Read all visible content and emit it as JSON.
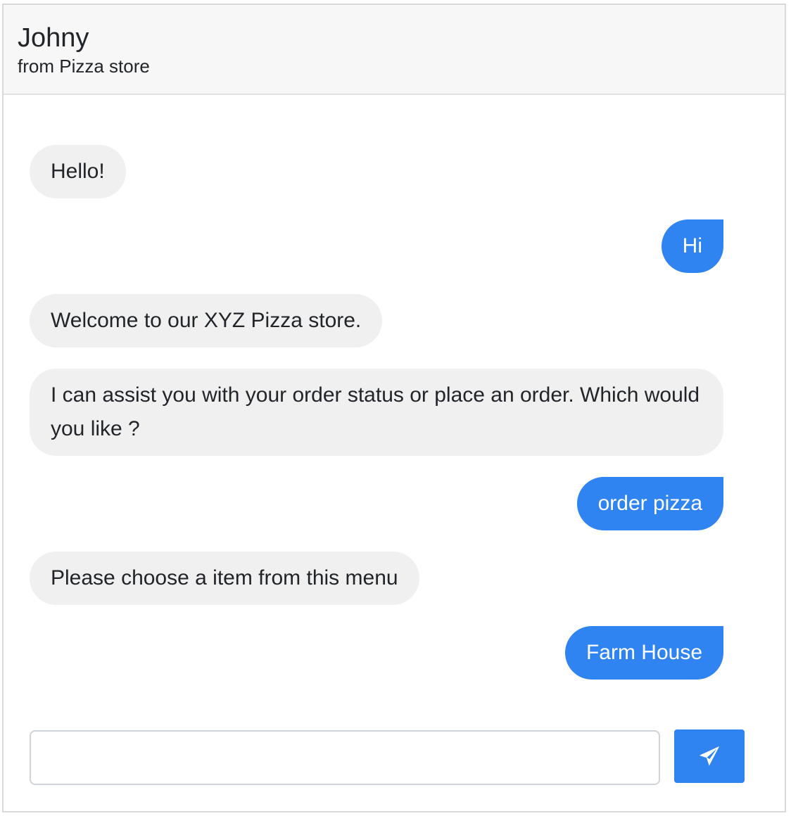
{
  "header": {
    "name": "Johny",
    "subtitle": "from Pizza store"
  },
  "messages": [
    {
      "from": "bot",
      "text": "Hello!"
    },
    {
      "from": "user",
      "text": "Hi"
    },
    {
      "from": "bot",
      "text": "Welcome to our XYZ Pizza store."
    },
    {
      "from": "bot",
      "text": "I can assist you with your order status or place an order. Which would you like ?"
    },
    {
      "from": "user",
      "text": "order pizza"
    },
    {
      "from": "bot",
      "text": "Please choose a item from this menu"
    },
    {
      "from": "user",
      "text": "Farm House"
    }
  ],
  "composer": {
    "input_value": "",
    "send_icon": "paper-plane-icon"
  },
  "colors": {
    "accent": "#2f84f2",
    "bot_bubble": "#f0f0f0",
    "header_bg": "#f7f7f7"
  }
}
